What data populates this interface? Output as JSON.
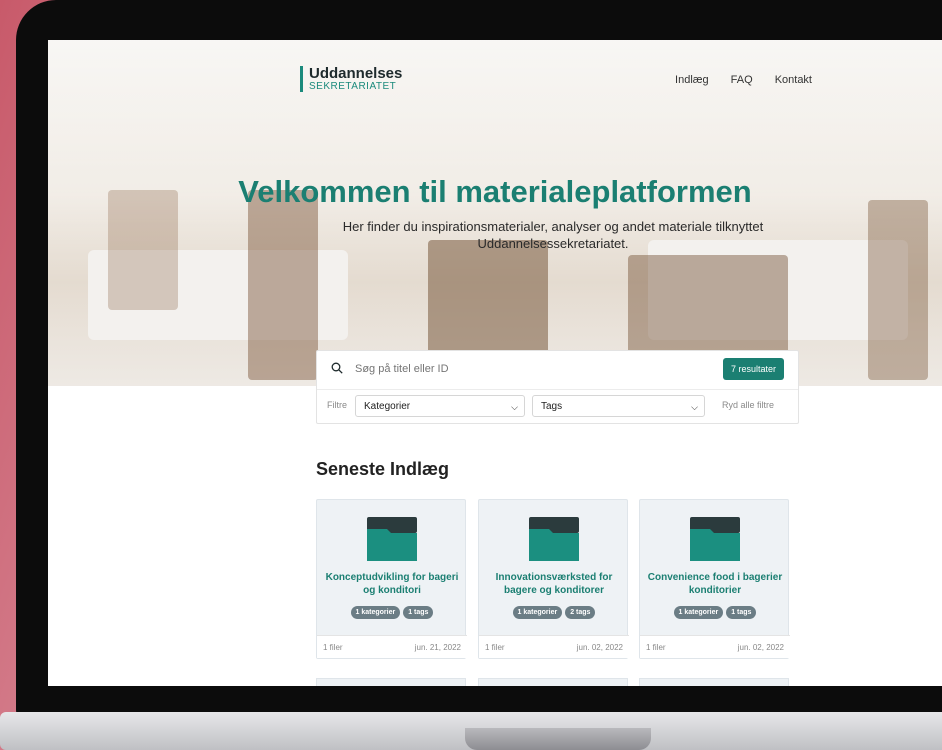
{
  "nav": {
    "logo_top": "Uddannelses",
    "logo_bottom": "SEKRETARIATET",
    "links": [
      "Indlæg",
      "FAQ",
      "Kontakt"
    ]
  },
  "hero": {
    "title": "Velkommen til materialeplatformen",
    "subtitle": "Her finder du inspirationsmaterialer, analyser og andet materiale tilknyttet Uddannelsessekretariatet."
  },
  "search": {
    "placeholder": "Søg på titel eller ID",
    "results_label": "7 resultater",
    "filters_label": "Filtre",
    "category_select": "Kategorier",
    "tags_select": "Tags",
    "clear_filters": "Ryd alle filtre"
  },
  "latest": {
    "title": "Seneste Indlæg",
    "cards": [
      {
        "title": "Konceptudvikling for bageri og konditori",
        "categories": "1 kategorier",
        "tags": "1 tags",
        "files": "1 filer",
        "date": "jun. 21, 2022"
      },
      {
        "title": "Innovationsværksted for bagere og konditorer",
        "categories": "1 kategorier",
        "tags": "2 tags",
        "files": "1 filer",
        "date": "jun. 02, 2022"
      },
      {
        "title": "Convenience food i bagerier konditorier",
        "categories": "1 kategorier",
        "tags": "1 tags",
        "files": "1 filer",
        "date": "jun. 02, 2022"
      }
    ]
  },
  "colors": {
    "accent": "#1b7f72",
    "badge": "#6b7d85",
    "card_bg": "#eef2f5"
  }
}
